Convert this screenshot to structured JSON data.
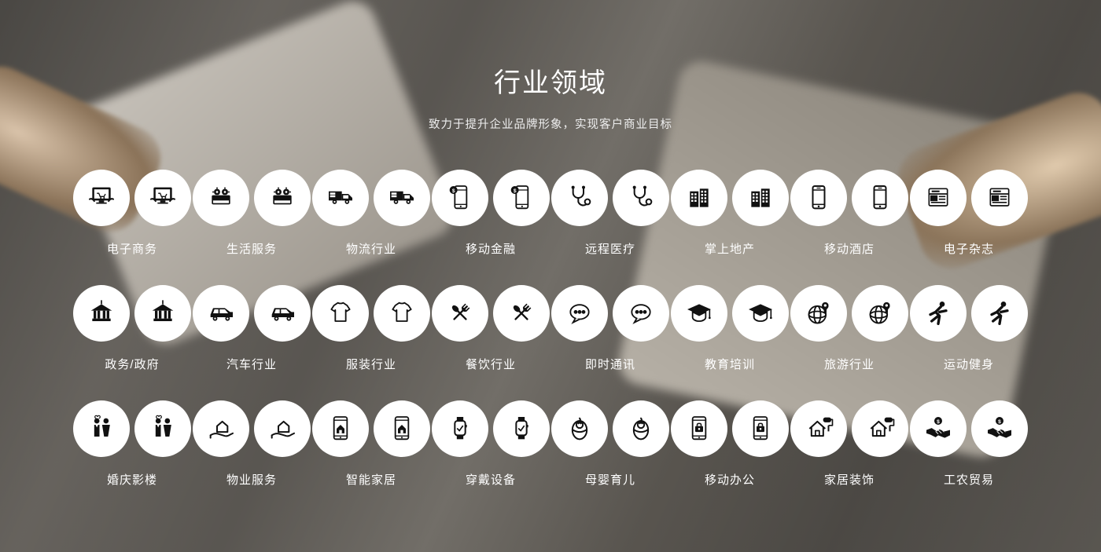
{
  "title": "行业领域",
  "subtitle": "致力于提升企业品牌形象，实现客户商业目标",
  "rows": [
    [
      {
        "label": "电子商务",
        "icon": "ecommerce"
      },
      {
        "label": "生活服务",
        "icon": "life-service"
      },
      {
        "label": "物流行业",
        "icon": "logistics"
      },
      {
        "label": "移动金融",
        "icon": "mobile-finance"
      },
      {
        "label": "远程医疗",
        "icon": "telemedicine"
      },
      {
        "label": "掌上地产",
        "icon": "real-estate"
      },
      {
        "label": "移动酒店",
        "icon": "mobile-hotel"
      },
      {
        "label": "电子杂志",
        "icon": "e-magazine"
      }
    ],
    [
      {
        "label": "政务/政府",
        "icon": "government"
      },
      {
        "label": "汽车行业",
        "icon": "automotive"
      },
      {
        "label": "服装行业",
        "icon": "apparel"
      },
      {
        "label": "餐饮行业",
        "icon": "catering"
      },
      {
        "label": "即时通讯",
        "icon": "instant-messaging"
      },
      {
        "label": "教育培训",
        "icon": "education"
      },
      {
        "label": "旅游行业",
        "icon": "travel"
      },
      {
        "label": "运动健身",
        "icon": "fitness"
      }
    ],
    [
      {
        "label": "婚庆影楼",
        "icon": "wedding"
      },
      {
        "label": "物业服务",
        "icon": "property-service"
      },
      {
        "label": "智能家居",
        "icon": "smart-home"
      },
      {
        "label": "穿戴设备",
        "icon": "wearable"
      },
      {
        "label": "母婴育儿",
        "icon": "maternal-infant"
      },
      {
        "label": "移动办公",
        "icon": "mobile-office"
      },
      {
        "label": "家居装饰",
        "icon": "home-decor"
      },
      {
        "label": "工农贸易",
        "icon": "trade"
      }
    ]
  ]
}
